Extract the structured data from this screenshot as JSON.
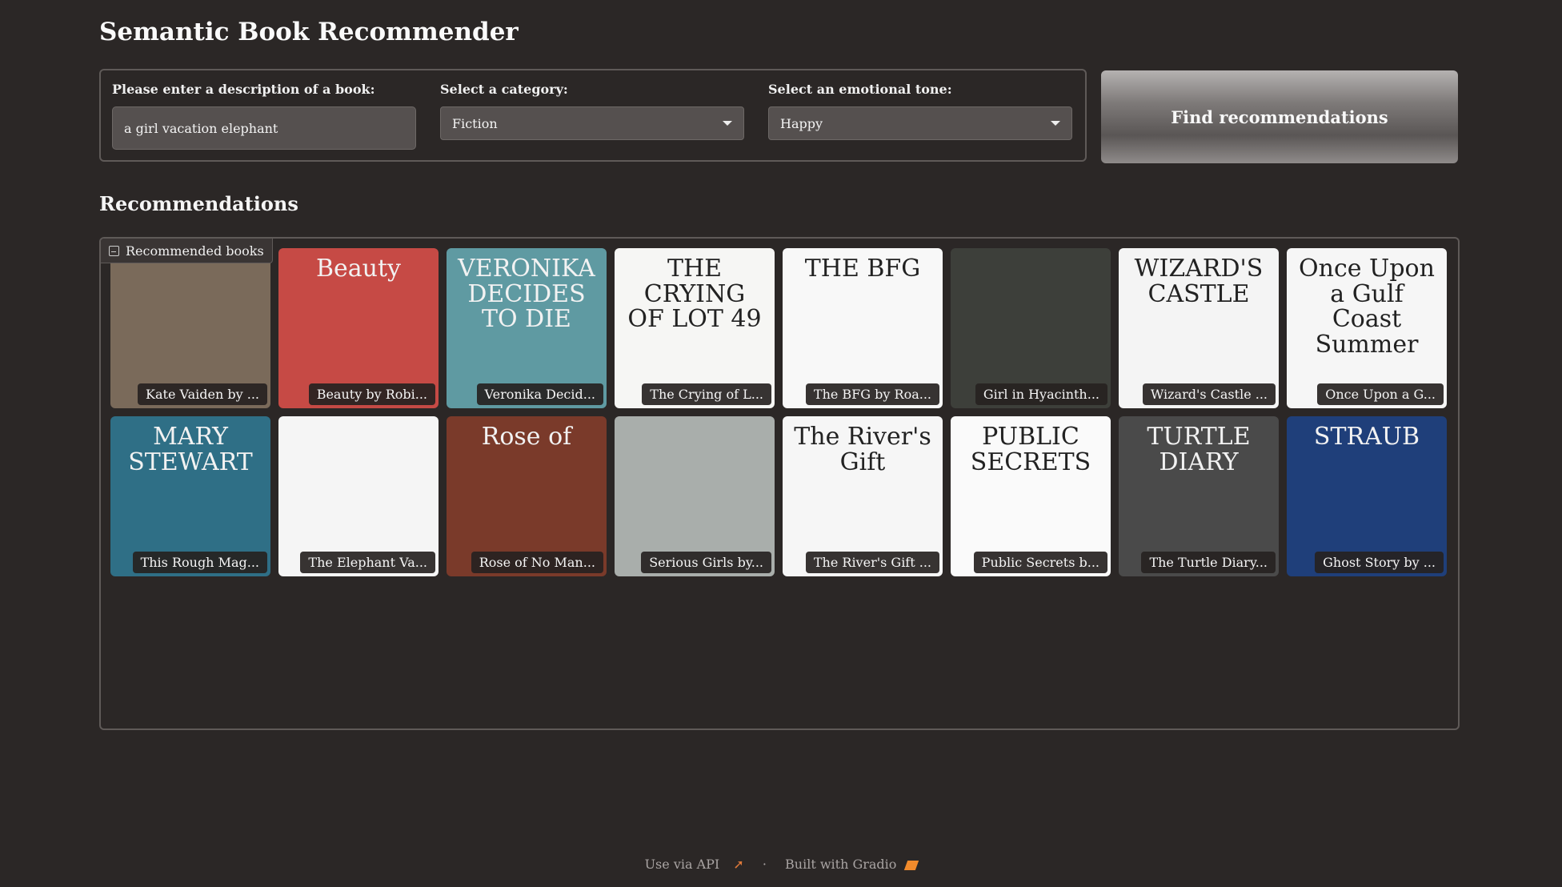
{
  "app": {
    "title": "Semantic Book Recommender"
  },
  "form": {
    "query": {
      "label": "Please enter a description of a book:",
      "value": "a girl vacation elephant"
    },
    "category": {
      "label": "Select a category:",
      "value": "Fiction"
    },
    "tone": {
      "label": "Select an emotional tone:",
      "value": "Happy"
    },
    "submit_label": "Find recommendations"
  },
  "results": {
    "section_title": "Recommendations",
    "gallery_label": "Recommended books",
    "books": [
      {
        "caption": "Kate Vaiden by ...",
        "cover_text": "",
        "bg": "#7a6a5a"
      },
      {
        "caption": "Beauty by Robi...",
        "cover_text": "Beauty",
        "bg": "#c64a45"
      },
      {
        "caption": "Veronika Decid...",
        "cover_text": "VERONIKA DECIDES TO DIE",
        "bg": "#5f9aa2"
      },
      {
        "caption": "The Crying of L...",
        "cover_text": "THE CRYING OF LOT 49",
        "bg": "#f6f6f4"
      },
      {
        "caption": "The BFG by Roa...",
        "cover_text": "THE BFG",
        "bg": "#f8f8f8"
      },
      {
        "caption": "Girl in Hyacinth...",
        "cover_text": "",
        "bg": "#3d3f3a"
      },
      {
        "caption": "Wizard's Castle ...",
        "cover_text": "WIZARD'S CASTLE",
        "bg": "#f4f4f4"
      },
      {
        "caption": "Once Upon a G...",
        "cover_text": "Once Upon a Gulf Coast Summer",
        "bg": "#f6f6f6"
      },
      {
        "caption": "This Rough Mag...",
        "cover_text": "MARY STEWART",
        "bg": "#2f6f86"
      },
      {
        "caption": "The Elephant Va...",
        "cover_text": "",
        "bg": "#f5f5f5"
      },
      {
        "caption": "Rose of No Man...",
        "cover_text": "Rose of",
        "bg": "#7a3a2a"
      },
      {
        "caption": "Serious Girls by...",
        "cover_text": "",
        "bg": "#a9aeab"
      },
      {
        "caption": "The River's Gift ...",
        "cover_text": "The River's Gift",
        "bg": "#f6f6f6"
      },
      {
        "caption": "Public Secrets b...",
        "cover_text": "PUBLIC SECRETS",
        "bg": "#fafafa"
      },
      {
        "caption": "The Turtle Diary...",
        "cover_text": "TURTLE DIARY",
        "bg": "#4a4a4a"
      },
      {
        "caption": "Ghost Story by ...",
        "cover_text": "STRAUB",
        "bg": "#1f3f7a"
      }
    ]
  },
  "footer": {
    "api_label": "Use via API",
    "separator": "·",
    "built_with": "Built with Gradio"
  }
}
